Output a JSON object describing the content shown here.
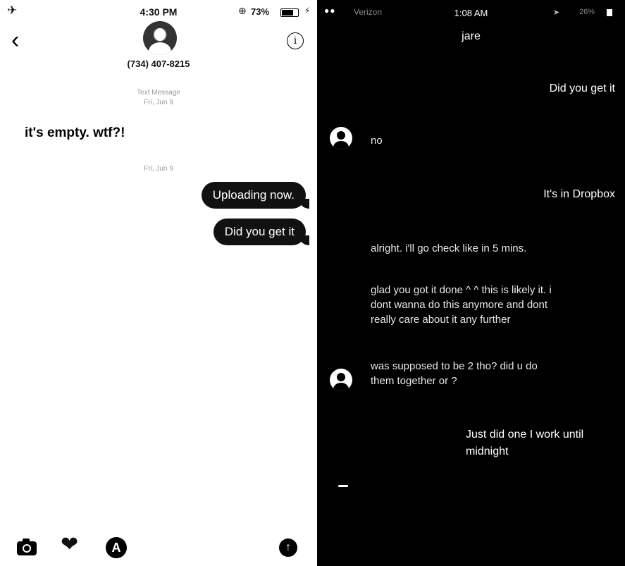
{
  "left": {
    "status": {
      "time": "4:30 PM",
      "battery": "73%"
    },
    "contact": {
      "number": "(734) 407-8215"
    },
    "meta": {
      "service": "Text Message",
      "date1": "Fri, Jun 9",
      "date2": "Fri, Jun 9"
    },
    "messages": {
      "received": "it's empty. wtf?!",
      "sent": [
        "Uploading now.",
        "Did you get it"
      ]
    },
    "icons": [
      "airplane-icon",
      "camera-icon",
      "heart-icon",
      "appstore-icon",
      "send-icon",
      "info-icon",
      "back-icon"
    ]
  },
  "right": {
    "status": {
      "carrier": "Verizon",
      "time": "1:08 AM",
      "battery": "26%"
    },
    "title": "jare",
    "messages": [
      {
        "side": "sent",
        "text": "Did you get it"
      },
      {
        "side": "received",
        "text": "no"
      },
      {
        "side": "sent",
        "text": "It's in Dropbox"
      },
      {
        "side": "received",
        "text": "alright. i'll go check like in 5 mins."
      },
      {
        "side": "received",
        "text": "glad you got it done ^ ^ this is likely it. i dont wanna do this anymore and dont really care about it any further"
      },
      {
        "side": "received",
        "text": "was supposed to be 2 tho? did u do them together or ?"
      },
      {
        "side": "sent",
        "text": "Just did one I work until midnight"
      }
    ]
  }
}
